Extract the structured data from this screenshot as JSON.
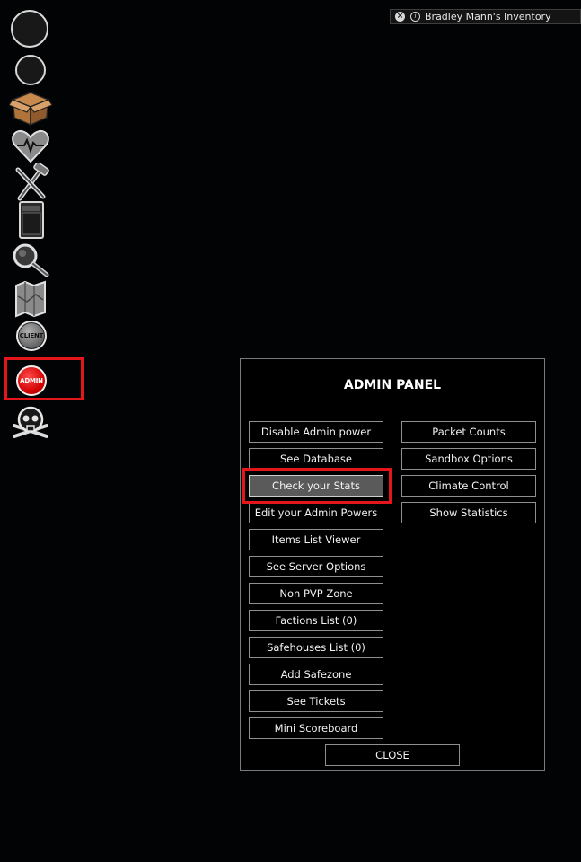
{
  "inventory_bar": {
    "title": "Bradley Mann's Inventory"
  },
  "sidebar": {
    "icons": [
      "avatar-large",
      "avatar-small",
      "box-icon",
      "heart-icon",
      "tools-icon",
      "cabinet-icon",
      "magnifier-icon",
      "map-icon",
      "client-icon",
      "admin-icon",
      "skull-icon"
    ],
    "client_label": "CLIENT",
    "admin_label": "ADMIN"
  },
  "admin_panel": {
    "title": "ADMIN PANEL",
    "left_buttons": [
      "Disable Admin power",
      "See Database",
      "Check your Stats",
      "Edit your Admin Powers",
      "Items List Viewer",
      "See Server Options",
      "Non PVP Zone",
      "Factions List (0)",
      "Safehouses List (0)",
      "Add Safezone",
      "See Tickets",
      "Mini Scoreboard"
    ],
    "right_buttons": [
      "Packet Counts",
      "Sandbox Options",
      "Climate Control",
      "Show Statistics"
    ],
    "close_label": "CLOSE"
  },
  "colors": {
    "highlight": "#e4161c",
    "panel_border": "#7a7a7a",
    "active_button": "#5a5a5a"
  }
}
